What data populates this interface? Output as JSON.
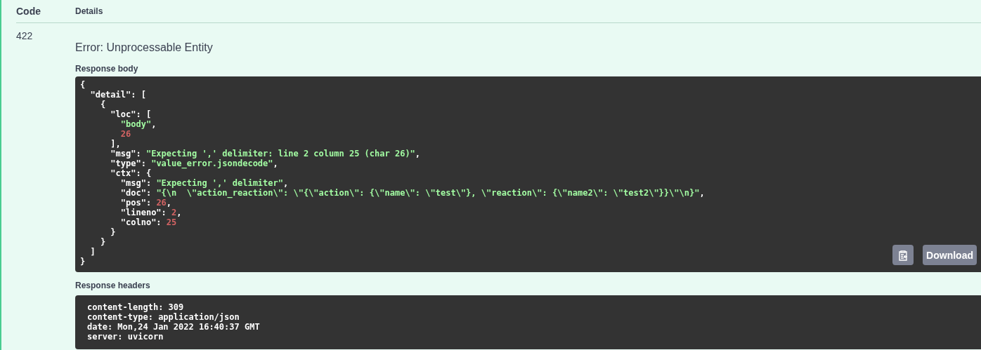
{
  "table": {
    "columns": [
      "Code",
      "Details"
    ],
    "rows": [
      {
        "code": "422",
        "error_title": "Error: Unprocessable Entity",
        "response_body": {
          "label": "Response body",
          "lines": [
            [
              {
                "kind": "plain",
                "text": "{"
              }
            ],
            [
              {
                "kind": "plain",
                "text": "  \"detail\": ["
              }
            ],
            [
              {
                "kind": "plain",
                "text": "    {"
              }
            ],
            [
              {
                "kind": "plain",
                "text": "      \"loc\": ["
              }
            ],
            [
              {
                "kind": "string",
                "text": "        \"body\""
              },
              {
                "kind": "plain",
                "text": ","
              }
            ],
            [
              {
                "kind": "number",
                "text": "        26"
              }
            ],
            [
              {
                "kind": "plain",
                "text": "      ],"
              }
            ],
            [
              {
                "kind": "plain",
                "text": "      \"msg\": "
              },
              {
                "kind": "string",
                "text": "\"Expecting ',' delimiter: line 2 column 25 (char 26)\""
              },
              {
                "kind": "plain",
                "text": ","
              }
            ],
            [
              {
                "kind": "plain",
                "text": "      \"type\": "
              },
              {
                "kind": "string",
                "text": "\"value_error.jsondecode\""
              },
              {
                "kind": "plain",
                "text": ","
              }
            ],
            [
              {
                "kind": "plain",
                "text": "      \"ctx\": {"
              }
            ],
            [
              {
                "kind": "plain",
                "text": "        \"msg\": "
              },
              {
                "kind": "string",
                "text": "\"Expecting ',' delimiter\""
              },
              {
                "kind": "plain",
                "text": ","
              }
            ],
            [
              {
                "kind": "plain",
                "text": "        \"doc\": "
              },
              {
                "kind": "string",
                "text": "\"{\\n  \\\"action_reaction\\\": \\\"{\\\"action\\\": {\\\"name\\\": \\\"test\\\"}, \\\"reaction\\\": {\\\"name2\\\": \\\"test2\\\"}}\\\"\\n}\""
              },
              {
                "kind": "plain",
                "text": ","
              }
            ],
            [
              {
                "kind": "plain",
                "text": "        \"pos\": "
              },
              {
                "kind": "number",
                "text": "26"
              },
              {
                "kind": "plain",
                "text": ","
              }
            ],
            [
              {
                "kind": "plain",
                "text": "        \"lineno\": "
              },
              {
                "kind": "number",
                "text": "2"
              },
              {
                "kind": "plain",
                "text": ","
              }
            ],
            [
              {
                "kind": "plain",
                "text": "        \"colno\": "
              },
              {
                "kind": "number",
                "text": "25"
              }
            ],
            [
              {
                "kind": "plain",
                "text": "      }"
              }
            ],
            [
              {
                "kind": "plain",
                "text": "    }"
              }
            ],
            [
              {
                "kind": "plain",
                "text": "  ]"
              }
            ],
            [
              {
                "kind": "plain",
                "text": "}"
              }
            ]
          ],
          "download_button": "Download"
        },
        "response_headers": {
          "label": "Response headers",
          "lines": [
            "content-length: 309",
            "content-type: application/json",
            "date: Mon,24 Jan 2022 16:40:37 GMT",
            "server: uvicorn"
          ]
        }
      }
    ]
  }
}
